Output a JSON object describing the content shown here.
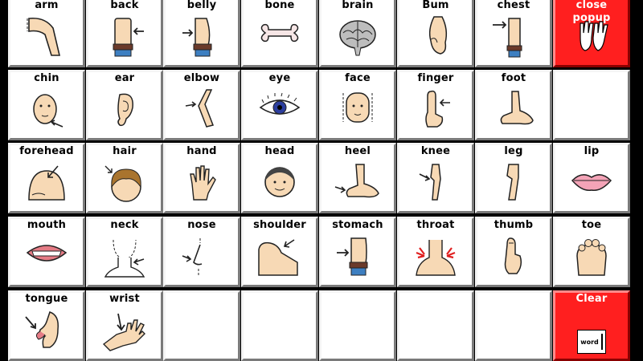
{
  "window": {
    "title": ""
  },
  "grid": [
    [
      {
        "label": "arm",
        "icon": "arm-icon",
        "color": "white"
      },
      {
        "label": "back",
        "icon": "back-icon",
        "color": "white"
      },
      {
        "label": "belly",
        "icon": "belly-icon",
        "color": "white"
      },
      {
        "label": "bone",
        "icon": "bone-icon",
        "color": "white"
      },
      {
        "label": "brain",
        "icon": "brain-icon",
        "color": "white"
      },
      {
        "label": "Bum",
        "icon": "bum-icon",
        "color": "white"
      },
      {
        "label": "chest",
        "icon": "chest-icon",
        "color": "white"
      },
      {
        "label": "close popup",
        "icon": "hands-icon",
        "color": "red"
      }
    ],
    [
      {
        "label": "chin",
        "icon": "chin-icon",
        "color": "white"
      },
      {
        "label": "ear",
        "icon": "ear-icon",
        "color": "white"
      },
      {
        "label": "elbow",
        "icon": "elbow-icon",
        "color": "white"
      },
      {
        "label": "eye",
        "icon": "eye-icon",
        "color": "white"
      },
      {
        "label": "face",
        "icon": "face-icon",
        "color": "white"
      },
      {
        "label": "finger",
        "icon": "finger-icon",
        "color": "white"
      },
      {
        "label": "foot",
        "icon": "foot-icon",
        "color": "white"
      },
      {
        "label": "",
        "icon": "",
        "color": "white"
      }
    ],
    [
      {
        "label": "forehead",
        "icon": "forehead-icon",
        "color": "white"
      },
      {
        "label": "hair",
        "icon": "hair-icon",
        "color": "white"
      },
      {
        "label": "hand",
        "icon": "hand-icon",
        "color": "white"
      },
      {
        "label": "head",
        "icon": "head-icon",
        "color": "white"
      },
      {
        "label": "heel",
        "icon": "heel-icon",
        "color": "white"
      },
      {
        "label": "knee",
        "icon": "knee-icon",
        "color": "white"
      },
      {
        "label": "leg",
        "icon": "leg-icon",
        "color": "white"
      },
      {
        "label": "lip",
        "icon": "lips-icon",
        "color": "white"
      }
    ],
    [
      {
        "label": "mouth",
        "icon": "mouth-icon",
        "color": "white"
      },
      {
        "label": "neck",
        "icon": "neck-icon",
        "color": "white"
      },
      {
        "label": "nose",
        "icon": "nose-icon",
        "color": "white"
      },
      {
        "label": "shoulder",
        "icon": "shoulder-icon",
        "color": "white"
      },
      {
        "label": "stomach",
        "icon": "stomach-icon",
        "color": "white"
      },
      {
        "label": "throat",
        "icon": "throat-icon",
        "color": "white"
      },
      {
        "label": "thumb",
        "icon": "thumb-icon",
        "color": "white"
      },
      {
        "label": "toe",
        "icon": "toe-icon",
        "color": "white"
      }
    ],
    [
      {
        "label": "tongue",
        "icon": "tongue-icon",
        "color": "white"
      },
      {
        "label": "wrist",
        "icon": "wrist-icon",
        "color": "white"
      },
      {
        "label": "",
        "icon": "",
        "color": "white"
      },
      {
        "label": "",
        "icon": "",
        "color": "white"
      },
      {
        "label": "",
        "icon": "",
        "color": "white"
      },
      {
        "label": "",
        "icon": "",
        "color": "white"
      },
      {
        "label": "",
        "icon": "",
        "color": "white"
      },
      {
        "label": "Clear",
        "icon": "clear-word-icon",
        "color": "red"
      }
    ]
  ],
  "clear_word_text": "word",
  "colors": {
    "accent_red": "#ff1f1f",
    "skin": "#f7d9b5",
    "background": "#000000"
  }
}
